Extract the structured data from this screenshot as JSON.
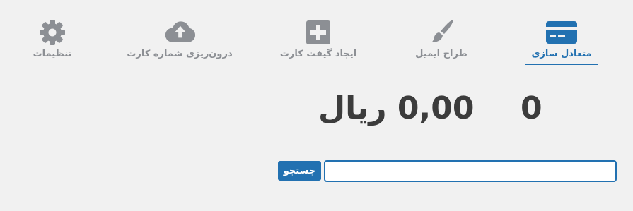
{
  "tabs": {
    "balance": {
      "label": "متعادل سازی",
      "icon": "credit-card-icon",
      "active": true
    },
    "email": {
      "label": "طراح ایمیل",
      "icon": "paintbrush-icon"
    },
    "create": {
      "label": "ایجاد گیفت کارت",
      "icon": "plus-square-icon"
    },
    "import": {
      "label": "درون‌ریزی شماره کارت",
      "icon": "cloud-upload-icon"
    },
    "settings": {
      "label": "تنظیمات",
      "icon": "gear-icon"
    }
  },
  "stats": {
    "count": "0",
    "amount": "0,00 ریال"
  },
  "search": {
    "value": "",
    "placeholder": "",
    "button_label": "جستجو"
  },
  "colors": {
    "accent": "#2271b1",
    "inactive": "#8c8f94",
    "background": "#f1f1f1",
    "stat_text": "#3c3c3c"
  }
}
